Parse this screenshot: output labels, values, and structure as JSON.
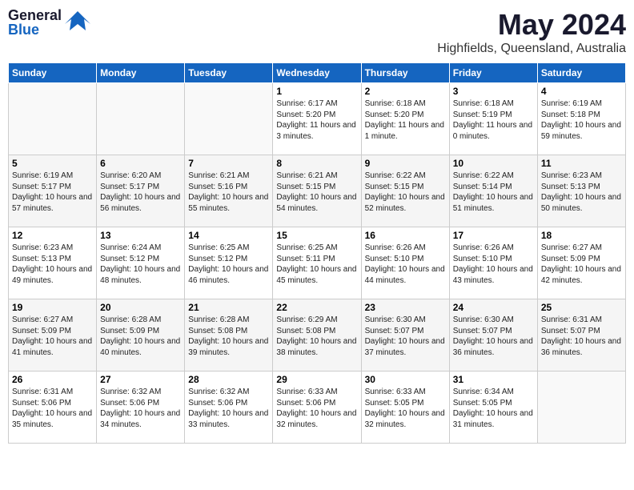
{
  "header": {
    "logo_general": "General",
    "logo_blue": "Blue",
    "month_title": "May 2024",
    "location": "Highfields, Queensland, Australia"
  },
  "days_of_week": [
    "Sunday",
    "Monday",
    "Tuesday",
    "Wednesday",
    "Thursday",
    "Friday",
    "Saturday"
  ],
  "weeks": [
    [
      {
        "day": "",
        "info": ""
      },
      {
        "day": "",
        "info": ""
      },
      {
        "day": "",
        "info": ""
      },
      {
        "day": "1",
        "info": "Sunrise: 6:17 AM\nSunset: 5:20 PM\nDaylight: 11 hours and 3 minutes."
      },
      {
        "day": "2",
        "info": "Sunrise: 6:18 AM\nSunset: 5:20 PM\nDaylight: 11 hours and 1 minute."
      },
      {
        "day": "3",
        "info": "Sunrise: 6:18 AM\nSunset: 5:19 PM\nDaylight: 11 hours and 0 minutes."
      },
      {
        "day": "4",
        "info": "Sunrise: 6:19 AM\nSunset: 5:18 PM\nDaylight: 10 hours and 59 minutes."
      }
    ],
    [
      {
        "day": "5",
        "info": "Sunrise: 6:19 AM\nSunset: 5:17 PM\nDaylight: 10 hours and 57 minutes."
      },
      {
        "day": "6",
        "info": "Sunrise: 6:20 AM\nSunset: 5:17 PM\nDaylight: 10 hours and 56 minutes."
      },
      {
        "day": "7",
        "info": "Sunrise: 6:21 AM\nSunset: 5:16 PM\nDaylight: 10 hours and 55 minutes."
      },
      {
        "day": "8",
        "info": "Sunrise: 6:21 AM\nSunset: 5:15 PM\nDaylight: 10 hours and 54 minutes."
      },
      {
        "day": "9",
        "info": "Sunrise: 6:22 AM\nSunset: 5:15 PM\nDaylight: 10 hours and 52 minutes."
      },
      {
        "day": "10",
        "info": "Sunrise: 6:22 AM\nSunset: 5:14 PM\nDaylight: 10 hours and 51 minutes."
      },
      {
        "day": "11",
        "info": "Sunrise: 6:23 AM\nSunset: 5:13 PM\nDaylight: 10 hours and 50 minutes."
      }
    ],
    [
      {
        "day": "12",
        "info": "Sunrise: 6:23 AM\nSunset: 5:13 PM\nDaylight: 10 hours and 49 minutes."
      },
      {
        "day": "13",
        "info": "Sunrise: 6:24 AM\nSunset: 5:12 PM\nDaylight: 10 hours and 48 minutes."
      },
      {
        "day": "14",
        "info": "Sunrise: 6:25 AM\nSunset: 5:12 PM\nDaylight: 10 hours and 46 minutes."
      },
      {
        "day": "15",
        "info": "Sunrise: 6:25 AM\nSunset: 5:11 PM\nDaylight: 10 hours and 45 minutes."
      },
      {
        "day": "16",
        "info": "Sunrise: 6:26 AM\nSunset: 5:10 PM\nDaylight: 10 hours and 44 minutes."
      },
      {
        "day": "17",
        "info": "Sunrise: 6:26 AM\nSunset: 5:10 PM\nDaylight: 10 hours and 43 minutes."
      },
      {
        "day": "18",
        "info": "Sunrise: 6:27 AM\nSunset: 5:09 PM\nDaylight: 10 hours and 42 minutes."
      }
    ],
    [
      {
        "day": "19",
        "info": "Sunrise: 6:27 AM\nSunset: 5:09 PM\nDaylight: 10 hours and 41 minutes."
      },
      {
        "day": "20",
        "info": "Sunrise: 6:28 AM\nSunset: 5:09 PM\nDaylight: 10 hours and 40 minutes."
      },
      {
        "day": "21",
        "info": "Sunrise: 6:28 AM\nSunset: 5:08 PM\nDaylight: 10 hours and 39 minutes."
      },
      {
        "day": "22",
        "info": "Sunrise: 6:29 AM\nSunset: 5:08 PM\nDaylight: 10 hours and 38 minutes."
      },
      {
        "day": "23",
        "info": "Sunrise: 6:30 AM\nSunset: 5:07 PM\nDaylight: 10 hours and 37 minutes."
      },
      {
        "day": "24",
        "info": "Sunrise: 6:30 AM\nSunset: 5:07 PM\nDaylight: 10 hours and 36 minutes."
      },
      {
        "day": "25",
        "info": "Sunrise: 6:31 AM\nSunset: 5:07 PM\nDaylight: 10 hours and 36 minutes."
      }
    ],
    [
      {
        "day": "26",
        "info": "Sunrise: 6:31 AM\nSunset: 5:06 PM\nDaylight: 10 hours and 35 minutes."
      },
      {
        "day": "27",
        "info": "Sunrise: 6:32 AM\nSunset: 5:06 PM\nDaylight: 10 hours and 34 minutes."
      },
      {
        "day": "28",
        "info": "Sunrise: 6:32 AM\nSunset: 5:06 PM\nDaylight: 10 hours and 33 minutes."
      },
      {
        "day": "29",
        "info": "Sunrise: 6:33 AM\nSunset: 5:06 PM\nDaylight: 10 hours and 32 minutes."
      },
      {
        "day": "30",
        "info": "Sunrise: 6:33 AM\nSunset: 5:05 PM\nDaylight: 10 hours and 32 minutes."
      },
      {
        "day": "31",
        "info": "Sunrise: 6:34 AM\nSunset: 5:05 PM\nDaylight: 10 hours and 31 minutes."
      },
      {
        "day": "",
        "info": ""
      }
    ]
  ]
}
